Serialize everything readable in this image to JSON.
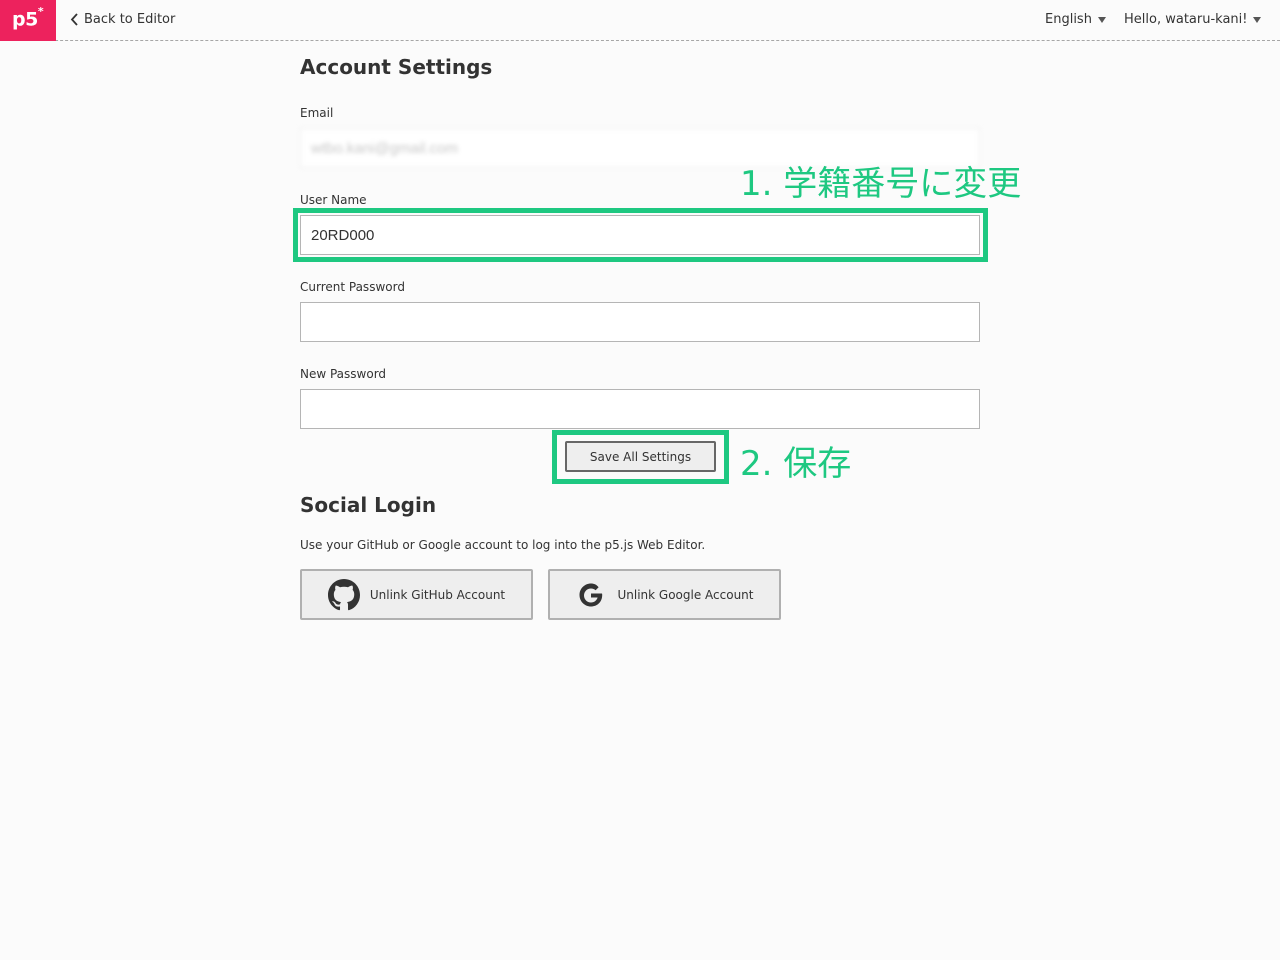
{
  "nav": {
    "logo": "p5",
    "logo_sup": "*",
    "back": "Back to Editor",
    "language": "English",
    "user_menu": "Hello, wataru-kani!"
  },
  "account": {
    "title": "Account Settings",
    "email_label": "Email",
    "email_value": "wtbo.kani@gmail.com",
    "username_label": "User Name",
    "username_value": "20RD000",
    "current_password_label": "Current Password",
    "new_password_label": "New Password",
    "save_label": "Save All Settings"
  },
  "annotations": {
    "step1": "1. 学籍番号に変更",
    "step2": "2. 保存",
    "color": "#1ec881"
  },
  "social": {
    "title": "Social Login",
    "description": "Use your GitHub or Google account to log into the p5.js Web Editor.",
    "github_label": "Unlink GitHub Account",
    "google_label": "Unlink Google Account"
  },
  "colors": {
    "brand": "#ed225d",
    "background": "#fbfbfb"
  }
}
